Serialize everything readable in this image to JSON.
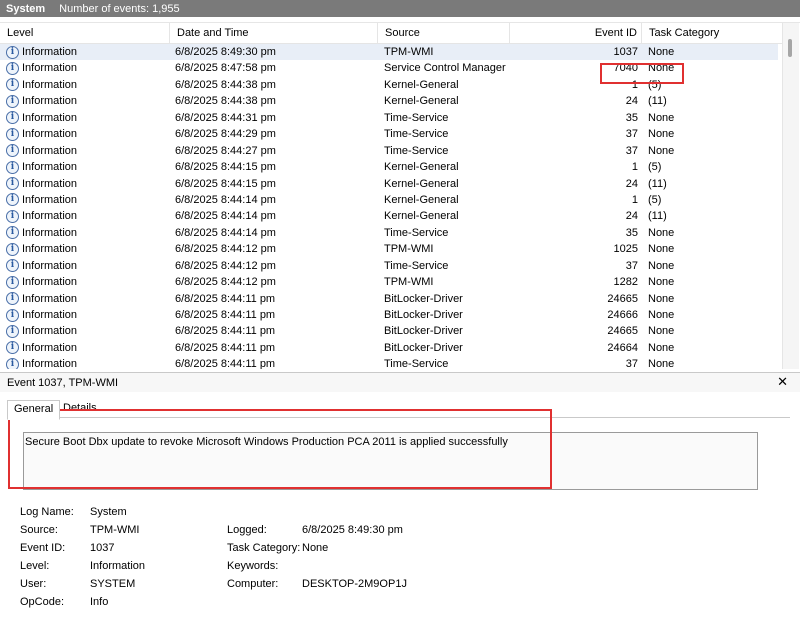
{
  "titlebar": {
    "log_name": "System",
    "count_text": "Number of events: 1,955"
  },
  "grid": {
    "headers": {
      "level": "Level",
      "date": "Date and Time",
      "source": "Source",
      "event_id": "Event ID",
      "task": "Task Category"
    },
    "rows": [
      {
        "level": "Information",
        "date": "6/8/2025 8:49:30 pm",
        "source": "TPM-WMI",
        "id": "1037",
        "task": "None"
      },
      {
        "level": "Information",
        "date": "6/8/2025 8:47:58 pm",
        "source": "Service Control Manager",
        "id": "7040",
        "task": "None"
      },
      {
        "level": "Information",
        "date": "6/8/2025 8:44:38 pm",
        "source": "Kernel-General",
        "id": "1",
        "task": "(5)"
      },
      {
        "level": "Information",
        "date": "6/8/2025 8:44:38 pm",
        "source": "Kernel-General",
        "id": "24",
        "task": "(11)"
      },
      {
        "level": "Information",
        "date": "6/8/2025 8:44:31 pm",
        "source": "Time-Service",
        "id": "35",
        "task": "None"
      },
      {
        "level": "Information",
        "date": "6/8/2025 8:44:29 pm",
        "source": "Time-Service",
        "id": "37",
        "task": "None"
      },
      {
        "level": "Information",
        "date": "6/8/2025 8:44:27 pm",
        "source": "Time-Service",
        "id": "37",
        "task": "None"
      },
      {
        "level": "Information",
        "date": "6/8/2025 8:44:15 pm",
        "source": "Kernel-General",
        "id": "1",
        "task": "(5)"
      },
      {
        "level": "Information",
        "date": "6/8/2025 8:44:15 pm",
        "source": "Kernel-General",
        "id": "24",
        "task": "(11)"
      },
      {
        "level": "Information",
        "date": "6/8/2025 8:44:14 pm",
        "source": "Kernel-General",
        "id": "1",
        "task": "(5)"
      },
      {
        "level": "Information",
        "date": "6/8/2025 8:44:14 pm",
        "source": "Kernel-General",
        "id": "24",
        "task": "(11)"
      },
      {
        "level": "Information",
        "date": "6/8/2025 8:44:14 pm",
        "source": "Time-Service",
        "id": "35",
        "task": "None"
      },
      {
        "level": "Information",
        "date": "6/8/2025 8:44:12 pm",
        "source": "TPM-WMI",
        "id": "1025",
        "task": "None"
      },
      {
        "level": "Information",
        "date": "6/8/2025 8:44:12 pm",
        "source": "Time-Service",
        "id": "37",
        "task": "None"
      },
      {
        "level": "Information",
        "date": "6/8/2025 8:44:12 pm",
        "source": "TPM-WMI",
        "id": "1282",
        "task": "None"
      },
      {
        "level": "Information",
        "date": "6/8/2025 8:44:11 pm",
        "source": "BitLocker-Driver",
        "id": "24665",
        "task": "None"
      },
      {
        "level": "Information",
        "date": "6/8/2025 8:44:11 pm",
        "source": "BitLocker-Driver",
        "id": "24666",
        "task": "None"
      },
      {
        "level": "Information",
        "date": "6/8/2025 8:44:11 pm",
        "source": "BitLocker-Driver",
        "id": "24665",
        "task": "None"
      },
      {
        "level": "Information",
        "date": "6/8/2025 8:44:11 pm",
        "source": "BitLocker-Driver",
        "id": "24664",
        "task": "None"
      },
      {
        "level": "Information",
        "date": "6/8/2025 8:44:11 pm",
        "source": "Time-Service",
        "id": "37",
        "task": "None"
      }
    ]
  },
  "detail": {
    "title": "Event 1037, TPM-WMI",
    "tabs": {
      "general": "General",
      "details": "Details"
    },
    "message": "Secure Boot Dbx update to revoke Microsoft Windows Production PCA 2011 is applied successfully",
    "props": {
      "log_name_label": "Log Name:",
      "log_name": "System",
      "source_label": "Source:",
      "source": "TPM-WMI",
      "event_id_label": "Event ID:",
      "event_id": "1037",
      "level_label": "Level:",
      "level": "Information",
      "user_label": "User:",
      "user": "SYSTEM",
      "opcode_label": "OpCode:",
      "opcode": "Info",
      "logged_label": "Logged:",
      "logged": "6/8/2025 8:49:30 pm",
      "task_label": "Task Category:",
      "task": "None",
      "keywords_label": "Keywords:",
      "keywords": "",
      "computer_label": "Computer:",
      "computer": "DESKTOP-2M9OP1J"
    }
  },
  "colors": {
    "highlight_box": "#e03030",
    "titlebar_bg": "#7a7a7a",
    "selected_row": "#e8eef7"
  },
  "icons": {
    "row_level": "information-icon",
    "close": "close-icon"
  }
}
